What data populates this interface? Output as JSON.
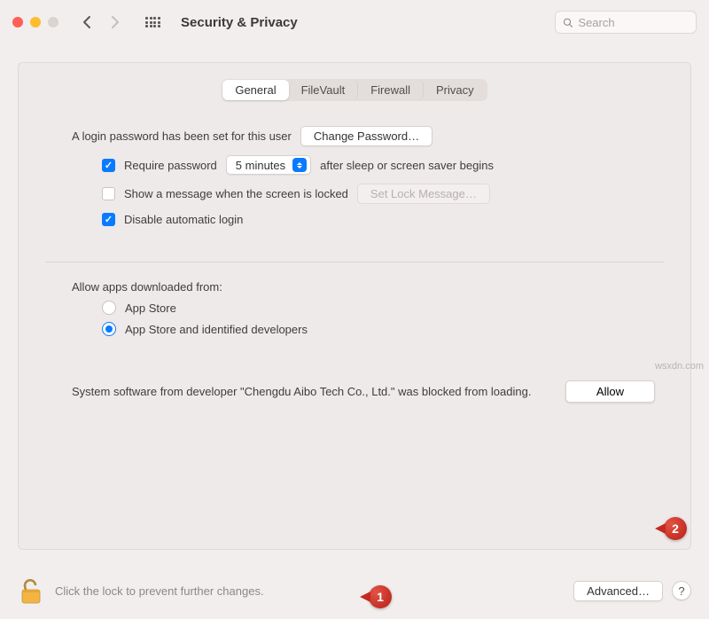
{
  "window": {
    "title": "Security & Privacy",
    "search_placeholder": "Search"
  },
  "tabs": {
    "items": [
      "General",
      "FileVault",
      "Firewall",
      "Privacy"
    ],
    "active_index": 0
  },
  "general": {
    "login_password_label": "A login password has been set for this user",
    "change_password_button": "Change Password…",
    "require_password": {
      "checked": true,
      "pre_label": "Require password",
      "select_value": "5 minutes",
      "post_label": "after sleep or screen saver begins"
    },
    "show_message": {
      "checked": false,
      "label": "Show a message when the screen is locked",
      "set_button": "Set Lock Message…"
    },
    "disable_auto_login": {
      "checked": true,
      "label": "Disable automatic login"
    },
    "allow_apps_title": "Allow apps downloaded from:",
    "allow_apps_options": [
      "App Store",
      "App Store and identified developers"
    ],
    "allow_apps_selected_index": 1,
    "blocked_software_text": "System software from developer \"Chengdu Aibo Tech Co., Ltd.\" was blocked from loading.",
    "allow_button": "Allow"
  },
  "footer": {
    "lock_text": "Click the lock to prevent further changes.",
    "advanced_button": "Advanced…",
    "help_button": "?"
  },
  "annotations": {
    "one": "1",
    "two": "2"
  },
  "watermark": "wsxdn.com"
}
